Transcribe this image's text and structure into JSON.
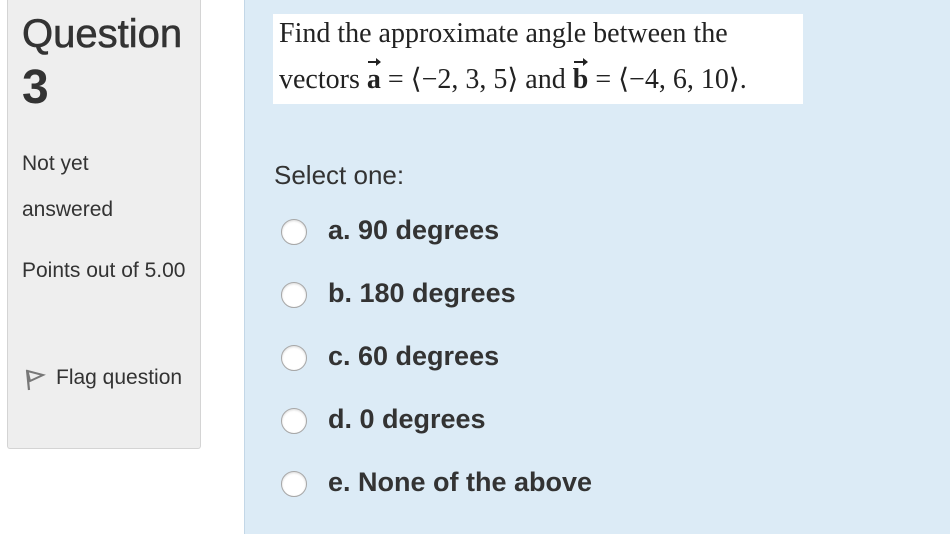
{
  "info": {
    "question_word": "Question",
    "question_number": "3",
    "state": "Not yet answered",
    "grade": "Points out of 5.00",
    "flag_label": "Flag question"
  },
  "question": {
    "line1": "Find the approximate angle between the",
    "line2_prefix": "vectors",
    "vector_a": "a",
    "vector_a_value": "= ⟨−2, 3, 5⟩",
    "and": "and",
    "vector_b": "b",
    "vector_b_value": "= ⟨−4, 6, 10⟩."
  },
  "prompt": "Select one:",
  "answers": [
    {
      "label": "a. 90 degrees"
    },
    {
      "label": "b. 180 degrees"
    },
    {
      "label": "c. 60 degrees"
    },
    {
      "label": "d. 0 degrees"
    },
    {
      "label": "e. None of the above"
    }
  ],
  "colors": {
    "content_bg": "#dcebf6",
    "info_bg": "#eeeeee",
    "text": "#333333"
  }
}
